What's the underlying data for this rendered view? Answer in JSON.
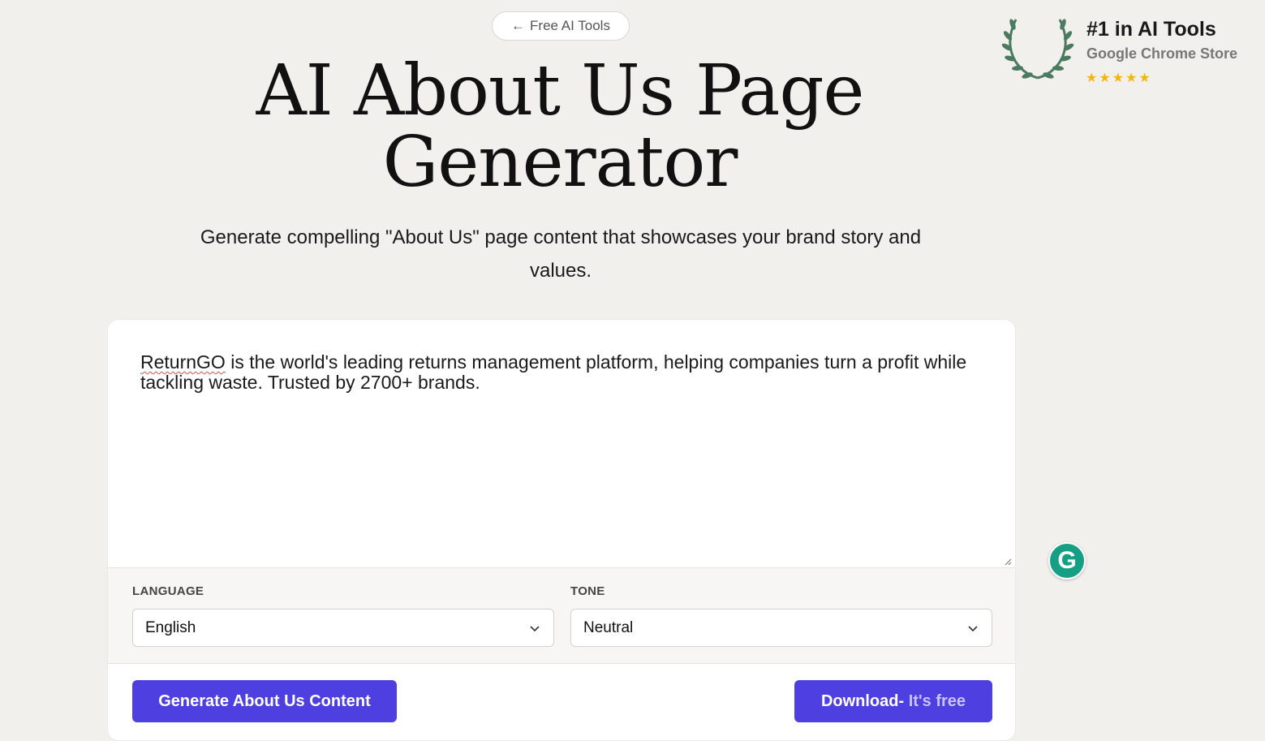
{
  "nav": {
    "back_label": "Free AI Tools"
  },
  "header": {
    "title_line1": "AI About Us Page",
    "title_line2": "Generator",
    "subtitle": "Generate compelling \"About Us\" page content that showcases your brand story and values."
  },
  "badge": {
    "title": "#1 in AI Tools",
    "subtitle": "Google Chrome Store",
    "stars": "★★★★★",
    "rating": 5
  },
  "form": {
    "input_word1": "ReturnGO",
    "input_rest": " is the world's leading returns management platform, helping companies turn a profit while tackling waste. Trusted by 2700+ brands.",
    "language_label": "LANGUAGE",
    "language_value": "English",
    "tone_label": "TONE",
    "tone_value": "Neutral",
    "generate_label": "Generate About Us Content",
    "download_label": "Download-",
    "download_suffix": " It's free"
  },
  "colors": {
    "background": "#f1f0ed",
    "accent": "#4e3fe0",
    "star": "#f6b50e",
    "laurel": "#4a7a60",
    "grammarly": "#15a086"
  },
  "icons": {
    "back": "arrow-left-icon",
    "laurel": "laurel-wreath-icon",
    "dropdown": "chevron-down-icon",
    "grammarly": "grammarly-icon"
  }
}
